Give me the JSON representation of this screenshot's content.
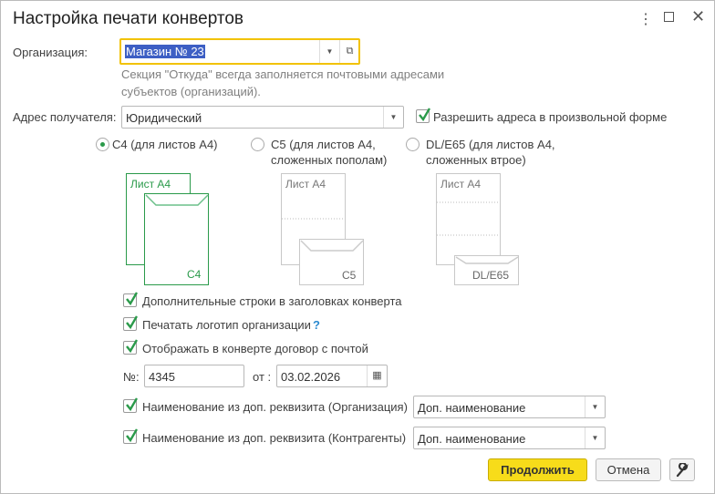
{
  "window": {
    "title": "Настройка печати конвертов",
    "more_icon": "more-vertical-icon",
    "maximize_icon": "maximize-icon",
    "close_icon": "close-icon"
  },
  "organization": {
    "label": "Организация:",
    "value": "Магазин № 23",
    "hint_line1": "Секция \"Откуда\" всегда заполняется почтовыми адресами",
    "hint_line2": "субъектов (организаций)."
  },
  "recipient": {
    "label": "Адрес получателя:",
    "value": "Юридический",
    "allow_free_form_label": "Разрешить адреса в произвольной форме",
    "allow_free_form_checked": true
  },
  "formats": [
    {
      "line1": "C4 (для листов А4)",
      "line2": "",
      "selected": true,
      "sheet_label": "Лист А4",
      "envelope_label": "C4"
    },
    {
      "line1": "C5 (для листов А4,",
      "line2": "сложенных пополам)",
      "selected": false,
      "sheet_label": "Лист А4",
      "envelope_label": "C5"
    },
    {
      "line1": "DL/E65 (для листов А4,",
      "line2": "сложенных втрое)",
      "selected": false,
      "sheet_label": "Лист А4",
      "envelope_label": "DL/E65"
    }
  ],
  "options": {
    "extra_lines": {
      "label": "Дополнительные строки в заголовках конверта",
      "checked": true
    },
    "print_logo": {
      "label": "Печатать логотип организации",
      "checked": true,
      "help": "?"
    },
    "show_contract": {
      "label": "Отображать в конверте договор с почтой",
      "checked": true
    }
  },
  "contract": {
    "number_label": "№:",
    "number": "4345",
    "date_label": "от :",
    "date": "03.02.2026"
  },
  "name_org": {
    "label": "Наименование из доп. реквизита (Организация)",
    "checked": true,
    "value": "Доп. наименование"
  },
  "name_contr": {
    "label": "Наименование из доп. реквизита (Контрагенты)",
    "checked": true,
    "value": "Доп. наименование"
  },
  "buttons": {
    "continue": "Продолжить",
    "cancel": "Отмена"
  },
  "colors": {
    "accent_green": "#2a9a4a",
    "primary_button": "#f7dc1a",
    "focus_border": "#f2c200",
    "selection": "#3d5fc4"
  }
}
